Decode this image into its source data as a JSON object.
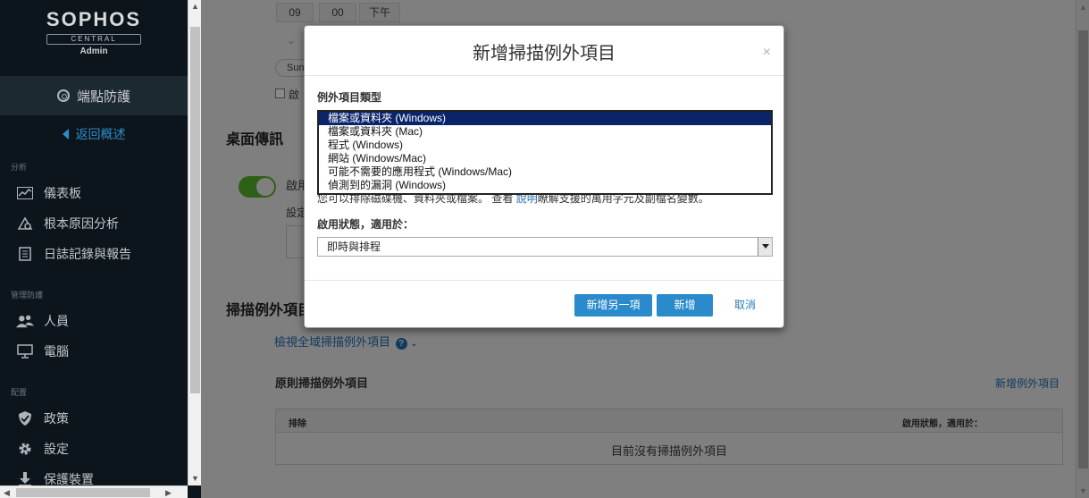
{
  "sidebar": {
    "logo": {
      "brand": "SOPHOS",
      "central": "CENTRAL",
      "role": "Admin"
    },
    "product": "端點防護",
    "back_link": "返回概述",
    "sections": [
      {
        "title": "分析",
        "items": [
          "儀表板",
          "根本原因分析",
          "日誌記錄與報告"
        ]
      },
      {
        "title": "管理防護",
        "items": [
          "人員",
          "電腦"
        ]
      },
      {
        "title": "配置",
        "items": [
          "政策",
          "設定",
          "保護裝置"
        ]
      }
    ]
  },
  "background": {
    "time": {
      "hour": "09",
      "minute": "00",
      "ampm": "下午"
    },
    "day_chip": "Sun",
    "checkbox_label": "啟",
    "desktop_msg": {
      "heading": "桌面傳訊",
      "toggle_label": "啟用",
      "sub_label": "設定"
    },
    "scan_exclusions": {
      "heading": "掃描例外項目",
      "view_global": "檢視全域掃描例外項目",
      "policy_heading": "原則掃描例外項目",
      "add_link": "新增例外項目",
      "table": {
        "col_exclusion": "排除",
        "col_active": "啟用狀態，適用於：",
        "empty": "目前沒有掃描例外項目"
      }
    }
  },
  "dialog": {
    "title": "新增掃描例外項目",
    "close": "×",
    "type_label": "例外項目類型",
    "type_options": [
      "檔案或資料夾 (Windows)",
      "檔案或資料夾 (Mac)",
      "程式 (Windows)",
      "網站 (Windows/Mac)",
      "可能不需要的應用程式 (Windows/Mac)",
      "偵測到的漏洞 (Windows)"
    ],
    "hint": {
      "pre": "您可以排除磁碟機、",
      "mid": "資料夾或檔案。",
      "see": "查看",
      "link": "說明",
      "post": "瞭解支援的萬用字元及副檔名變數。"
    },
    "active_label": "啟用狀態，適用於：",
    "active_value": "即時與排程",
    "buttons": {
      "add_another": "新增另一項",
      "add": "新增",
      "cancel": "取消"
    }
  },
  "colors": {
    "accent": "#2b8acb",
    "sidebar_bg": "#0b151b",
    "selected_option": "#0a246a"
  }
}
